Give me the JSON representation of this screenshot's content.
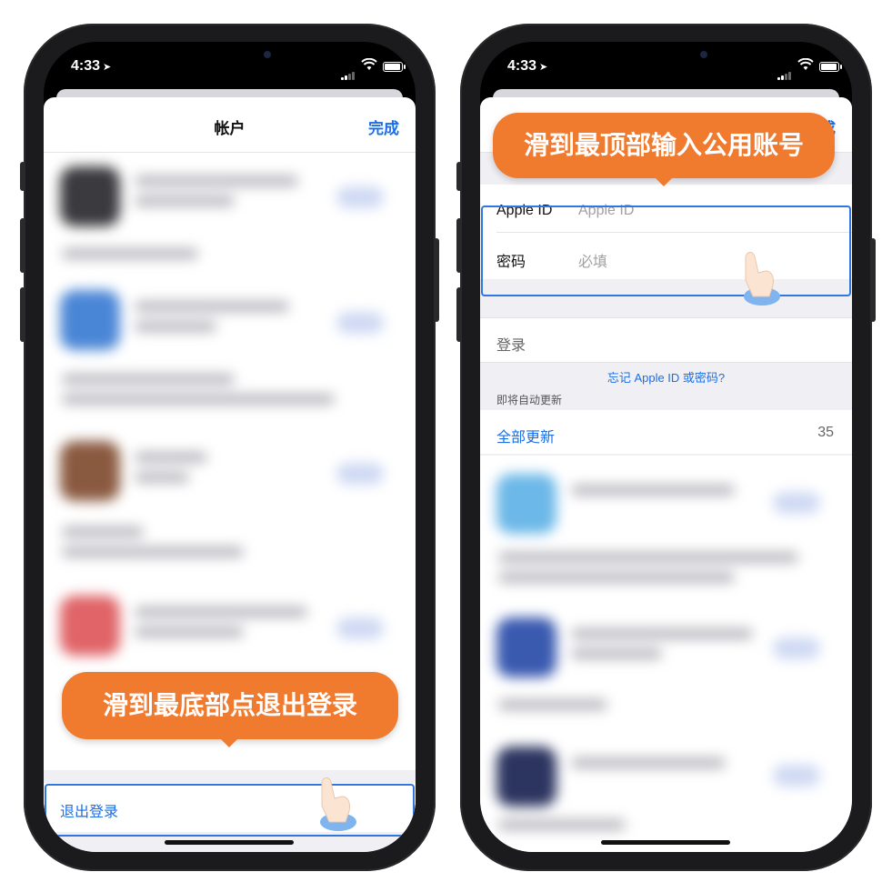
{
  "status_bar": {
    "time": "4:33",
    "location_icon": "location-arrow-icon"
  },
  "left_phone": {
    "nav_title": "帐户",
    "nav_done": "完成",
    "sign_out_label": "退出登录",
    "callout": "滑到最底部点退出登录"
  },
  "right_phone": {
    "callout": "滑到最顶部输入公用账号",
    "nav_done_partial": "成",
    "apple_id_label": "Apple ID",
    "apple_id_placeholder": "Apple ID",
    "password_label": "密码",
    "password_placeholder": "必填",
    "login_label": "登录",
    "forgot_link": "忘记 Apple ID 或密码?",
    "auto_update_header": "即将自动更新",
    "update_all_label": "全部更新",
    "update_count": "35"
  },
  "colors": {
    "accent": "#1a6ee8",
    "callout": "#f07a2e",
    "highlight": "#2f76e0"
  }
}
